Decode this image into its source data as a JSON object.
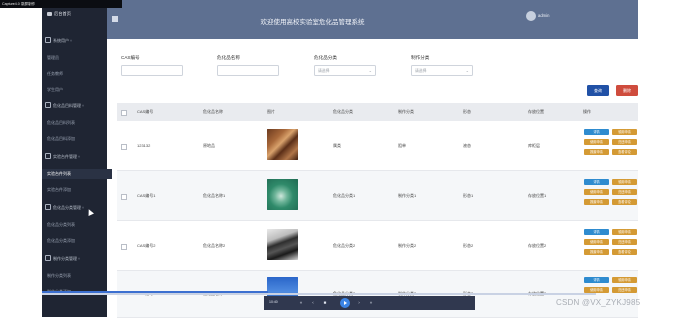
{
  "window": {
    "capture_title": "Capture4.0 录屏制作"
  },
  "header": {
    "system_title": "欢迎使用高校实验室危化品管理系统",
    "username": "admin"
  },
  "sidebar": {
    "title": "后台首页",
    "items": [
      {
        "label": "系统用户",
        "kind": "group",
        "chevron": "˅"
      },
      {
        "label": "管理员",
        "kind": "sub"
      },
      {
        "label": "任务教师",
        "kind": "sub"
      },
      {
        "label": "学生用户",
        "kind": "sub"
      },
      {
        "label": "危化品目料管理",
        "kind": "group",
        "chevron": "˅"
      },
      {
        "label": "危化品目料列表",
        "kind": "sub"
      },
      {
        "label": "危化品目料添加",
        "kind": "sub"
      },
      {
        "label": "实验台件管理",
        "kind": "group",
        "chevron": "˅"
      },
      {
        "label": "实验台件列表",
        "kind": "sub",
        "active": true
      },
      {
        "label": "实验台件添加",
        "kind": "sub"
      },
      {
        "label": "危化品分类管理",
        "kind": "group",
        "chevron": "˅"
      },
      {
        "label": "危化品分类列表",
        "kind": "sub"
      },
      {
        "label": "危化品分类添加",
        "kind": "sub"
      },
      {
        "label": "制作分类管理",
        "kind": "group",
        "chevron": "˅"
      },
      {
        "label": "制作分类列表",
        "kind": "sub"
      },
      {
        "label": "制作分类添加",
        "kind": "sub"
      }
    ]
  },
  "filters": {
    "cas": {
      "label": "CAS编号",
      "placeholder": ""
    },
    "name": {
      "label": "危化品名称",
      "placeholder": ""
    },
    "category": {
      "label": "危化品分类",
      "placeholder": "请选择",
      "arrow": "⌄"
    },
    "make_category": {
      "label": "制作分类",
      "placeholder": "请选择",
      "arrow": "⌄"
    }
  },
  "buttons": {
    "search": "查询",
    "delete": "删除"
  },
  "table": {
    "columns": [
      "CAS编号",
      "危化品名称",
      "图片",
      "危化品分类",
      "制作分类",
      "形态",
      "存放位置",
      "操作"
    ],
    "rows": [
      {
        "cas": "123132",
        "name": "原地品",
        "category": "属类",
        "make_category": "阻单",
        "form": "液态",
        "location": "库柜层"
      },
      {
        "cas": "CAS编号1",
        "name": "危化品名称1",
        "category": "危化品分类1",
        "make_category": "制作分类1",
        "form": "形态1",
        "location": "存放位置1"
      },
      {
        "cas": "CAS编号2",
        "name": "危化品名称2",
        "category": "危化品分类2",
        "make_category": "制作分类2",
        "form": "形态2",
        "location": "存放位置2"
      },
      {
        "cas": "CAS编号3",
        "name": "危化品名称3",
        "category": "危化品分类3",
        "make_category": "制作分类3",
        "form": "形态3",
        "location": "存放位置3"
      }
    ],
    "actions": [
      "详情",
      "领用申请",
      "使用申请",
      "归还申请",
      "报废申请",
      "查看评论"
    ]
  },
  "video": {
    "time": "10:40",
    "controls": [
      "«",
      "‹",
      "■",
      "›",
      "»"
    ]
  },
  "watermark": "CSDN @VX_ZYKJ985"
}
